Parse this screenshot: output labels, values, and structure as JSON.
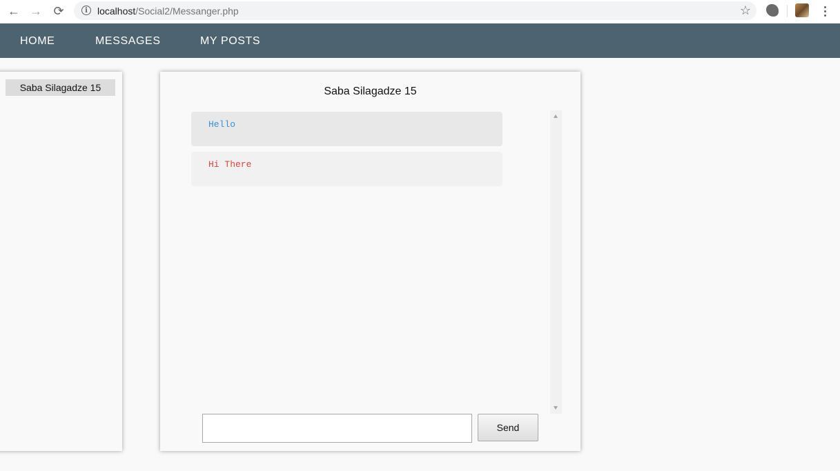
{
  "browser": {
    "url_host": "localhost",
    "url_path": "/Social2/Messanger.php",
    "back_icon": "←",
    "forward_icon": "→",
    "reload_icon": "⟳",
    "info_icon": "i",
    "star_icon": "☆"
  },
  "nav": {
    "items": [
      {
        "label": "HOME"
      },
      {
        "label": "MESSAGES"
      },
      {
        "label": "MY POSTS"
      }
    ]
  },
  "contacts": [
    {
      "name": "Saba Silagadze 15"
    }
  ],
  "chat": {
    "title": "Saba Silagadze 15",
    "messages": [
      {
        "text": "Hello",
        "direction": "incoming",
        "color": "#3a8fd6"
      },
      {
        "text": "Hi There",
        "direction": "outgoing",
        "color": "#d9453a"
      }
    ],
    "input_value": "",
    "send_label": "Send"
  },
  "colors": {
    "navbar": "#4e6370",
    "page_bg": "#f9f9f9"
  }
}
